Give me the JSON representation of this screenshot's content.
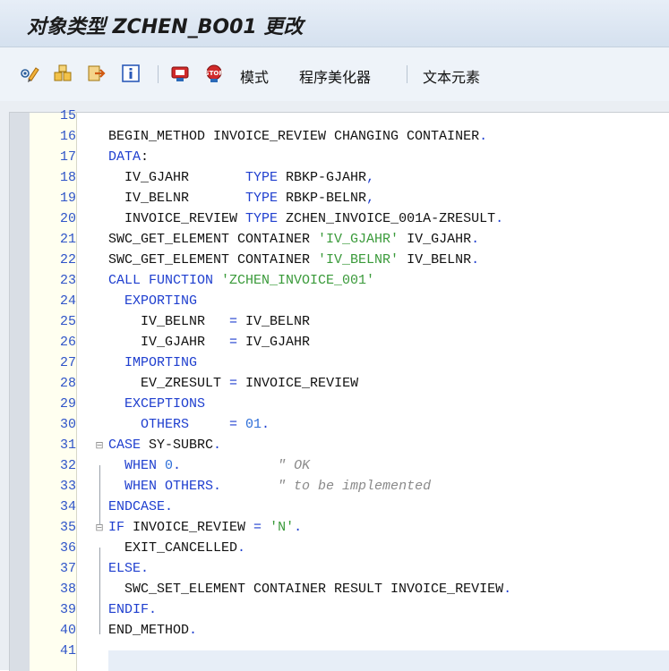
{
  "title": "对象类型 ZCHEN_BO01 更改",
  "toolbar": {
    "mode_label": "模式",
    "pretty_label": "程序美化器",
    "text_label": "文本元素"
  },
  "lines": [
    {
      "n": "15",
      "segs": []
    },
    {
      "n": "16",
      "segs": [
        {
          "t": "BEGIN_METHOD INVOICE_REVIEW CHANGING CONTAINER",
          "c": ""
        },
        {
          "t": ".",
          "c": "kw"
        }
      ]
    },
    {
      "n": "17",
      "segs": [
        {
          "t": "DATA",
          "c": "kw"
        },
        {
          "t": ":",
          "c": ""
        }
      ]
    },
    {
      "n": "18",
      "segs": [
        {
          "t": "  IV_GJAHR       ",
          "c": ""
        },
        {
          "t": "TYPE",
          "c": "kw"
        },
        {
          "t": " RBKP-GJAHR",
          "c": ""
        },
        {
          "t": ",",
          "c": "kw"
        }
      ]
    },
    {
      "n": "19",
      "segs": [
        {
          "t": "  IV_BELNR       ",
          "c": ""
        },
        {
          "t": "TYPE",
          "c": "kw"
        },
        {
          "t": " RBKP-BELNR",
          "c": ""
        },
        {
          "t": ",",
          "c": "kw"
        }
      ]
    },
    {
      "n": "20",
      "segs": [
        {
          "t": "  INVOICE_REVIEW ",
          "c": ""
        },
        {
          "t": "TYPE",
          "c": "kw"
        },
        {
          "t": " ZCHEN_INVOICE_001A-ZRESULT",
          "c": ""
        },
        {
          "t": ".",
          "c": "kw"
        }
      ]
    },
    {
      "n": "21",
      "segs": [
        {
          "t": "SWC_GET_ELEMENT CONTAINER ",
          "c": ""
        },
        {
          "t": "'IV_GJAHR'",
          "c": "str"
        },
        {
          "t": " IV_GJAHR",
          "c": ""
        },
        {
          "t": ".",
          "c": "kw"
        }
      ]
    },
    {
      "n": "22",
      "segs": [
        {
          "t": "SWC_GET_ELEMENT CONTAINER ",
          "c": ""
        },
        {
          "t": "'IV_BELNR'",
          "c": "str"
        },
        {
          "t": " IV_BELNR",
          "c": ""
        },
        {
          "t": ".",
          "c": "kw"
        }
      ]
    },
    {
      "n": "23",
      "segs": [
        {
          "t": "CALL FUNCTION ",
          "c": "kw"
        },
        {
          "t": "'ZCHEN_INVOICE_001'",
          "c": "str"
        }
      ]
    },
    {
      "n": "24",
      "segs": [
        {
          "t": "  EXPORTING",
          "c": "kw"
        }
      ]
    },
    {
      "n": "25",
      "segs": [
        {
          "t": "    IV_BELNR   ",
          "c": ""
        },
        {
          "t": "=",
          "c": "kw"
        },
        {
          "t": " IV_BELNR",
          "c": ""
        }
      ]
    },
    {
      "n": "26",
      "segs": [
        {
          "t": "    IV_GJAHR   ",
          "c": ""
        },
        {
          "t": "=",
          "c": "kw"
        },
        {
          "t": " IV_GJAHR",
          "c": ""
        }
      ]
    },
    {
      "n": "27",
      "segs": [
        {
          "t": "  IMPORTING",
          "c": "kw"
        }
      ]
    },
    {
      "n": "28",
      "segs": [
        {
          "t": "    EV_ZRESULT ",
          "c": ""
        },
        {
          "t": "=",
          "c": "kw"
        },
        {
          "t": " INVOICE_REVIEW",
          "c": ""
        }
      ]
    },
    {
      "n": "29",
      "segs": [
        {
          "t": "  EXCEPTIONS",
          "c": "kw"
        }
      ]
    },
    {
      "n": "30",
      "segs": [
        {
          "t": "    OTHERS     = ",
          "c": "kw"
        },
        {
          "t": "01",
          "c": "num"
        },
        {
          "t": ".",
          "c": "kw"
        }
      ]
    },
    {
      "n": "31",
      "fold": "⊟",
      "segs": [
        {
          "t": "CASE",
          "c": "kw"
        },
        {
          "t": " SY-SUBRC",
          "c": ""
        },
        {
          "t": ".",
          "c": "kw"
        }
      ]
    },
    {
      "n": "32",
      "segs": [
        {
          "t": "  WHEN ",
          "c": "kw"
        },
        {
          "t": "0",
          "c": "num"
        },
        {
          "t": ".",
          "c": "kw"
        },
        {
          "t": "            \" OK",
          "c": "cmt"
        }
      ]
    },
    {
      "n": "33",
      "segs": [
        {
          "t": "  WHEN OTHERS.",
          "c": "kw"
        },
        {
          "t": "       \" to be implemented",
          "c": "cmt"
        }
      ]
    },
    {
      "n": "34",
      "segs": [
        {
          "t": "ENDCASE.",
          "c": "kw"
        }
      ]
    },
    {
      "n": "35",
      "fold": "⊟",
      "segs": [
        {
          "t": "IF",
          "c": "kw"
        },
        {
          "t": " INVOICE_REVIEW ",
          "c": ""
        },
        {
          "t": "=",
          "c": "kw"
        },
        {
          "t": " ",
          "c": ""
        },
        {
          "t": "'N'",
          "c": "str"
        },
        {
          "t": ".",
          "c": "kw"
        }
      ]
    },
    {
      "n": "36",
      "segs": [
        {
          "t": "  EXIT_CANCELLED",
          "c": ""
        },
        {
          "t": ".",
          "c": "kw"
        }
      ]
    },
    {
      "n": "37",
      "segs": [
        {
          "t": "ELSE.",
          "c": "kw"
        }
      ]
    },
    {
      "n": "38",
      "segs": [
        {
          "t": "  SWC_SET_ELEMENT CONTAINER RESULT INVOICE_REVIEW",
          "c": ""
        },
        {
          "t": ".",
          "c": "kw"
        }
      ]
    },
    {
      "n": "39",
      "segs": [
        {
          "t": "ENDIF.",
          "c": "kw"
        }
      ]
    },
    {
      "n": "40",
      "segs": [
        {
          "t": "END_METHOD",
          "c": ""
        },
        {
          "t": ".",
          "c": "kw"
        }
      ]
    },
    {
      "n": "41",
      "segs": []
    }
  ]
}
